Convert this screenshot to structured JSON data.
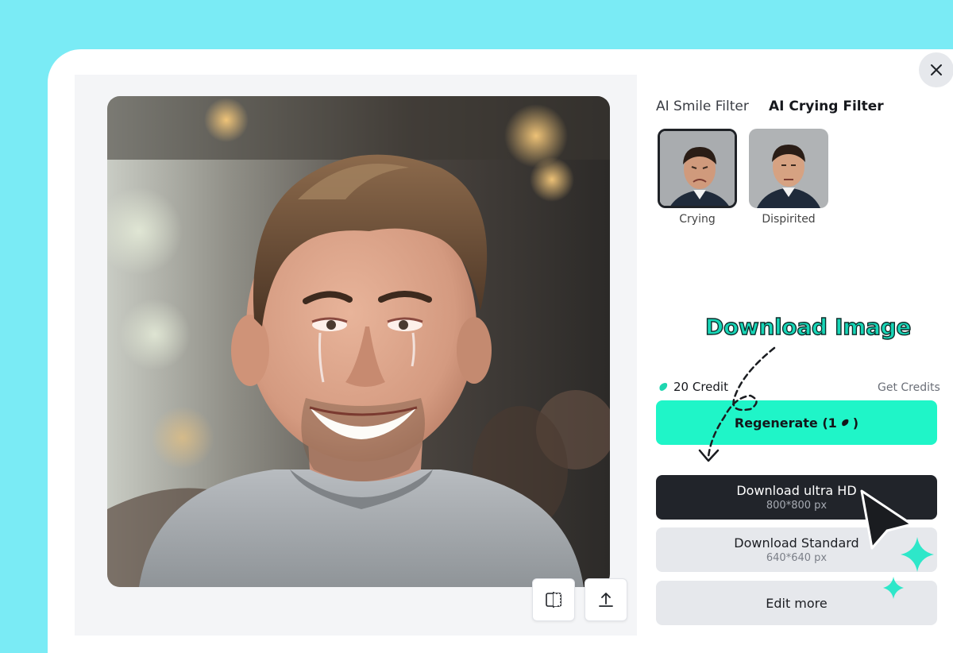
{
  "filters": {
    "tabs": [
      {
        "label": "AI Smile Filter",
        "active": false
      },
      {
        "label": "AI Crying Filter",
        "active": true
      }
    ],
    "presets": [
      {
        "label": "Crying",
        "selected": true
      },
      {
        "label": "Dispirited",
        "selected": false
      }
    ]
  },
  "annotation": {
    "text": "Download Image"
  },
  "credits": {
    "amount_label": "20 Credit",
    "get_label": "Get Credits"
  },
  "buttons": {
    "regenerate_label": "Regenerate (1",
    "regenerate_suffix": ")",
    "ultra_hd": {
      "label": "Download ultra HD",
      "size": "800*800 px"
    },
    "standard": {
      "label": "Download Standard",
      "size": "640*640 px"
    },
    "edit_more": "Edit more"
  },
  "icons": {
    "close": "close-icon",
    "compare": "compare-icon",
    "share": "share-icon",
    "credit": "credit-icon"
  },
  "colors": {
    "background": "#7aebf5",
    "accent": "#1ff5c8",
    "dark_button": "#21242a",
    "annotation": "#17d6b7"
  }
}
